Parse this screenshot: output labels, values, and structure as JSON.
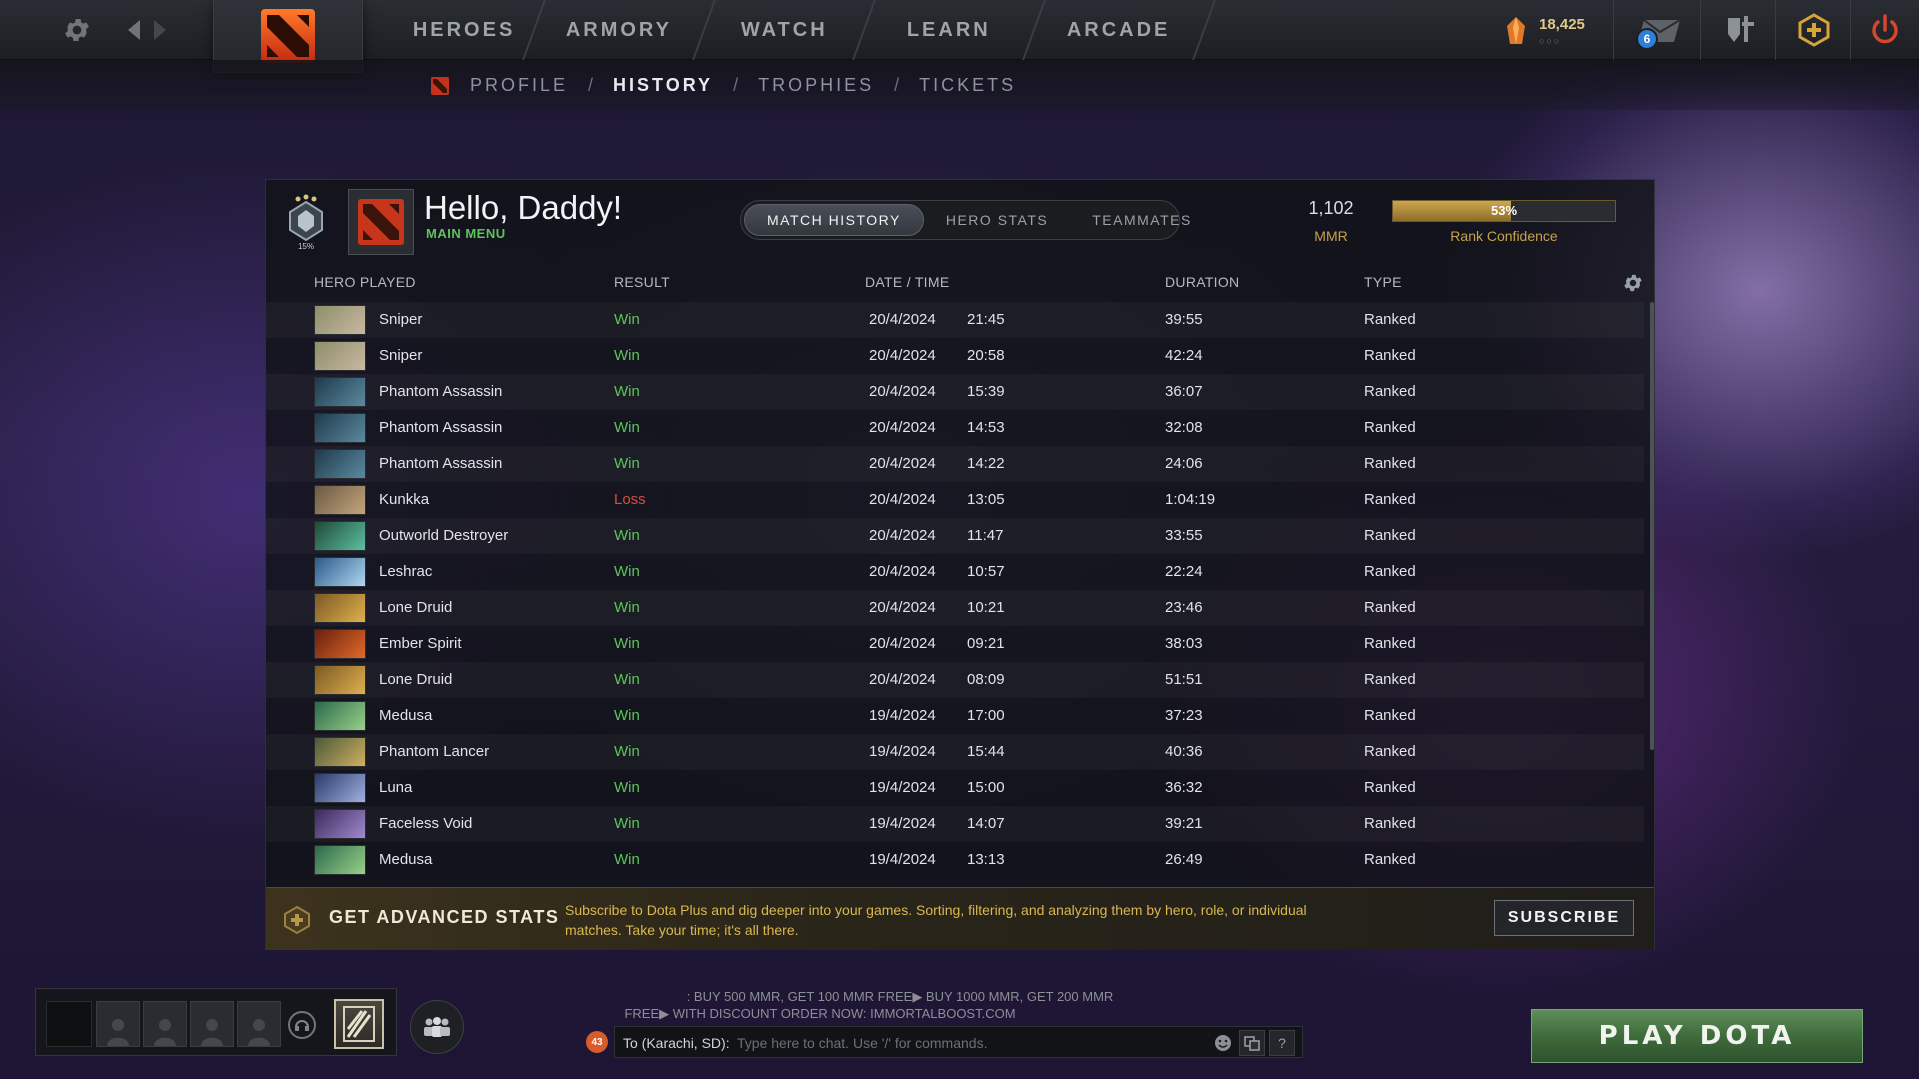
{
  "topbar": {
    "nav": [
      "HEROES",
      "ARMORY",
      "WATCH",
      "LEARN",
      "ARCADE"
    ],
    "shards": "18,425",
    "shard_dots": "○○○",
    "mail_badge": "6"
  },
  "subnav": {
    "items": [
      "PROFILE",
      "HISTORY",
      "TROPHIES",
      "TICKETS"
    ],
    "separator": "/",
    "active": "HISTORY"
  },
  "profile": {
    "greeting": "Hello, Daddy!",
    "subtitle": "MAIN MENU",
    "rank_percent": "15%",
    "mmr_value": "1,102",
    "mmr_label": "MMR",
    "rank_confidence": 53,
    "rank_confidence_text": "53%",
    "rank_confidence_label": "Rank Confidence"
  },
  "tabs": [
    "MATCH HISTORY",
    "HERO STATS",
    "TEAMMATES"
  ],
  "columns": {
    "hero": "HERO PLAYED",
    "result": "RESULT",
    "datetime": "DATE / TIME",
    "duration": "DURATION",
    "type": "TYPE"
  },
  "matches": [
    {
      "hero": "Sniper",
      "result": "Win",
      "date": "20/4/2024",
      "time": "21:45",
      "duration": "39:55",
      "type": "Ranked"
    },
    {
      "hero": "Sniper",
      "result": "Win",
      "date": "20/4/2024",
      "time": "20:58",
      "duration": "42:24",
      "type": "Ranked"
    },
    {
      "hero": "Phantom Assassin",
      "result": "Win",
      "date": "20/4/2024",
      "time": "15:39",
      "duration": "36:07",
      "type": "Ranked"
    },
    {
      "hero": "Phantom Assassin",
      "result": "Win",
      "date": "20/4/2024",
      "time": "14:53",
      "duration": "32:08",
      "type": "Ranked"
    },
    {
      "hero": "Phantom Assassin",
      "result": "Win",
      "date": "20/4/2024",
      "time": "14:22",
      "duration": "24:06",
      "type": "Ranked"
    },
    {
      "hero": "Kunkka",
      "result": "Loss",
      "date": "20/4/2024",
      "time": "13:05",
      "duration": "1:04:19",
      "type": "Ranked"
    },
    {
      "hero": "Outworld Destroyer",
      "result": "Win",
      "date": "20/4/2024",
      "time": "11:47",
      "duration": "33:55",
      "type": "Ranked"
    },
    {
      "hero": "Leshrac",
      "result": "Win",
      "date": "20/4/2024",
      "time": "10:57",
      "duration": "22:24",
      "type": "Ranked"
    },
    {
      "hero": "Lone Druid",
      "result": "Win",
      "date": "20/4/2024",
      "time": "10:21",
      "duration": "23:46",
      "type": "Ranked"
    },
    {
      "hero": "Ember Spirit",
      "result": "Win",
      "date": "20/4/2024",
      "time": "09:21",
      "duration": "38:03",
      "type": "Ranked"
    },
    {
      "hero": "Lone Druid",
      "result": "Win",
      "date": "20/4/2024",
      "time": "08:09",
      "duration": "51:51",
      "type": "Ranked"
    },
    {
      "hero": "Medusa",
      "result": "Win",
      "date": "19/4/2024",
      "time": "17:00",
      "duration": "37:23",
      "type": "Ranked"
    },
    {
      "hero": "Phantom Lancer",
      "result": "Win",
      "date": "19/4/2024",
      "time": "15:44",
      "duration": "40:36",
      "type": "Ranked"
    },
    {
      "hero": "Luna",
      "result": "Win",
      "date": "19/4/2024",
      "time": "15:00",
      "duration": "36:32",
      "type": "Ranked"
    },
    {
      "hero": "Faceless Void",
      "result": "Win",
      "date": "19/4/2024",
      "time": "14:07",
      "duration": "39:21",
      "type": "Ranked"
    },
    {
      "hero": "Medusa",
      "result": "Win",
      "date": "19/4/2024",
      "time": "13:13",
      "duration": "26:49",
      "type": "Ranked"
    }
  ],
  "promo": {
    "title": "GET ADVANCED STATS",
    "text": "Subscribe to Dota Plus and dig deeper into your games. Sorting, filtering, and analyzing them by hero, role, or individual matches. Take your time; it's all there.",
    "button": "SUBSCRIBE"
  },
  "chat": {
    "ad_line1": ": BUY 500 MMR, GET 100 MMR FREE▶ BUY 1000 MMR, GET 200 MMR",
    "ad_line2": "FREE▶ WITH DISCOUNT ORDER NOW: IMMORTALBOOST.COM",
    "badge": "43",
    "target": "To (Karachi, SD):",
    "placeholder": "Type here to chat. Use '/' for commands.",
    "help": "?"
  },
  "play_button": "PLAY DOTA",
  "colors": {
    "win": "#5ec45a",
    "loss": "#d94b3f",
    "gold": "#c9a24a",
    "play": "#3f6b3b"
  }
}
